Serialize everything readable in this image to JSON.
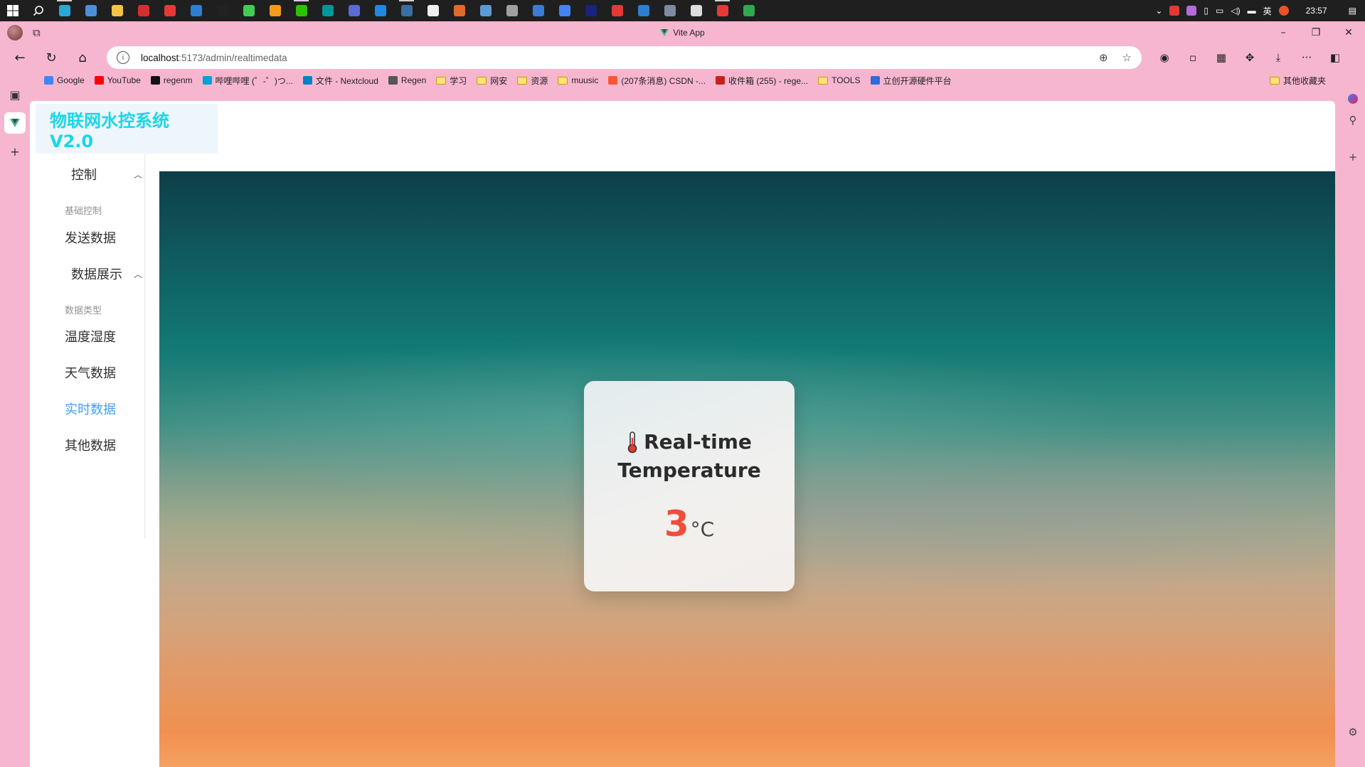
{
  "taskbar": {
    "clock": "23:57",
    "ime": "英",
    "apps": [
      {
        "name": "edge",
        "color": "#2aa7d8"
      },
      {
        "name": "monitor",
        "color": "#4c8fd6"
      },
      {
        "name": "explorer",
        "color": "#f3c445"
      },
      {
        "name": "wps",
        "color": "#d32f2f"
      },
      {
        "name": "xmind",
        "color": "#e53935"
      },
      {
        "name": "vscode",
        "color": "#2e7fd1"
      },
      {
        "name": "jetbrains",
        "color": "#222222"
      },
      {
        "name": "qt",
        "color": "#41cd52"
      },
      {
        "name": "app-orange",
        "color": "#f59b1d"
      },
      {
        "name": "wechat",
        "color": "#2dc100"
      },
      {
        "name": "arduino",
        "color": "#00979c"
      },
      {
        "name": "virtualbox",
        "color": "#5a6bd4"
      },
      {
        "name": "app-blue",
        "color": "#1e88e5"
      },
      {
        "name": "steam",
        "color": "#3a6ea5"
      },
      {
        "name": "typora",
        "color": "#eeeeee"
      },
      {
        "name": "fox",
        "color": "#e06a2c"
      },
      {
        "name": "remote",
        "color": "#5b9bd5"
      },
      {
        "name": "app-book",
        "color": "#a0a0a0"
      },
      {
        "name": "mx",
        "color": "#3a7bd5"
      },
      {
        "name": "app-circle",
        "color": "#4285f4"
      },
      {
        "name": "app-dark",
        "color": "#1a237e"
      },
      {
        "name": "netease",
        "color": "#e53935"
      },
      {
        "name": "vscode2",
        "color": "#2e7fd1"
      },
      {
        "name": "app-img",
        "color": "#7e8ba3"
      },
      {
        "name": "app-window",
        "color": "#dddddd"
      },
      {
        "name": "xmind2",
        "color": "#e53935"
      },
      {
        "name": "app-green",
        "color": "#2fa84f"
      }
    ]
  },
  "browser": {
    "title": "Vite App",
    "url_host": "localhost",
    "url_path": ":5173/admin/realtimedata",
    "bookmarks": [
      {
        "label": "Google",
        "type": "site",
        "color": "#4285f4"
      },
      {
        "label": "YouTube",
        "type": "site",
        "color": "#ff0000"
      },
      {
        "label": "regenm",
        "type": "site",
        "color": "#111111"
      },
      {
        "label": "哔哩哔哩 (゜-゜)つ...",
        "type": "site",
        "color": "#00a1d6"
      },
      {
        "label": "文件 - Nextcloud",
        "type": "site",
        "color": "#0082c9"
      },
      {
        "label": "Regen",
        "type": "site",
        "color": "#555555"
      },
      {
        "label": "学习",
        "type": "folder"
      },
      {
        "label": "网安",
        "type": "folder"
      },
      {
        "label": "资源",
        "type": "folder"
      },
      {
        "label": "muusic",
        "type": "folder"
      },
      {
        "label": "(207条消息) CSDN -...",
        "type": "site",
        "color": "#fc5531"
      },
      {
        "label": "收件箱 (255) - rege...",
        "type": "site",
        "color": "#c5221f"
      },
      {
        "label": "TOOLS",
        "type": "folder"
      },
      {
        "label": "立创开源硬件平台",
        "type": "site",
        "color": "#2d6cdf"
      }
    ],
    "other_bookmarks": "其他收藏夹"
  },
  "app": {
    "brand": "物联网水控系统 V2.0",
    "menu": {
      "group1": "控制",
      "group1_sub": "基础控制",
      "item_send": "发送数据",
      "group2": "数据展示",
      "group2_sub": "数据类型",
      "item_temphum": "温度湿度",
      "item_weather": "天气数据",
      "item_realtime": "实时数据",
      "item_other": "其他数据"
    },
    "card": {
      "title_line1": "Real-time",
      "title_line2": "Temperature",
      "value": "3",
      "unit": "°C"
    }
  }
}
